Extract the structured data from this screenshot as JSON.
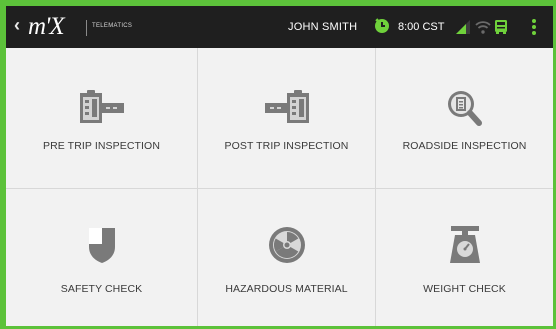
{
  "header": {
    "back_glyph": "‹",
    "logo_text": "m'X",
    "logo_subtitle": "TELEMATICS",
    "driver_name": "JOHN SMITH",
    "time": "8:00 CST",
    "icons": [
      "back-icon",
      "clock-icon",
      "signal-icon",
      "wifi-icon",
      "bus-icon",
      "overflow-menu-icon"
    ]
  },
  "tiles": [
    {
      "label": "PRE TRIP INSPECTION",
      "icon": "pre-trip-clipboard-icon"
    },
    {
      "label": "POST TRIP INSPECTION",
      "icon": "post-trip-clipboard-icon"
    },
    {
      "label": "ROADSIDE INSPECTION",
      "icon": "magnifier-document-icon"
    },
    {
      "label": "SAFETY CHECK",
      "icon": "shield-icon"
    },
    {
      "label": "HAZARDOUS MATERIAL",
      "icon": "radiation-icon"
    },
    {
      "label": "WEIGHT CHECK",
      "icon": "scale-icon"
    }
  ],
  "colors": {
    "frame": "#5cc23a",
    "topbar": "#1f1f1f",
    "tile_bg": "#f2f2f2",
    "icon_gray": "#7a7a7a",
    "status_green": "#6fd13b"
  }
}
